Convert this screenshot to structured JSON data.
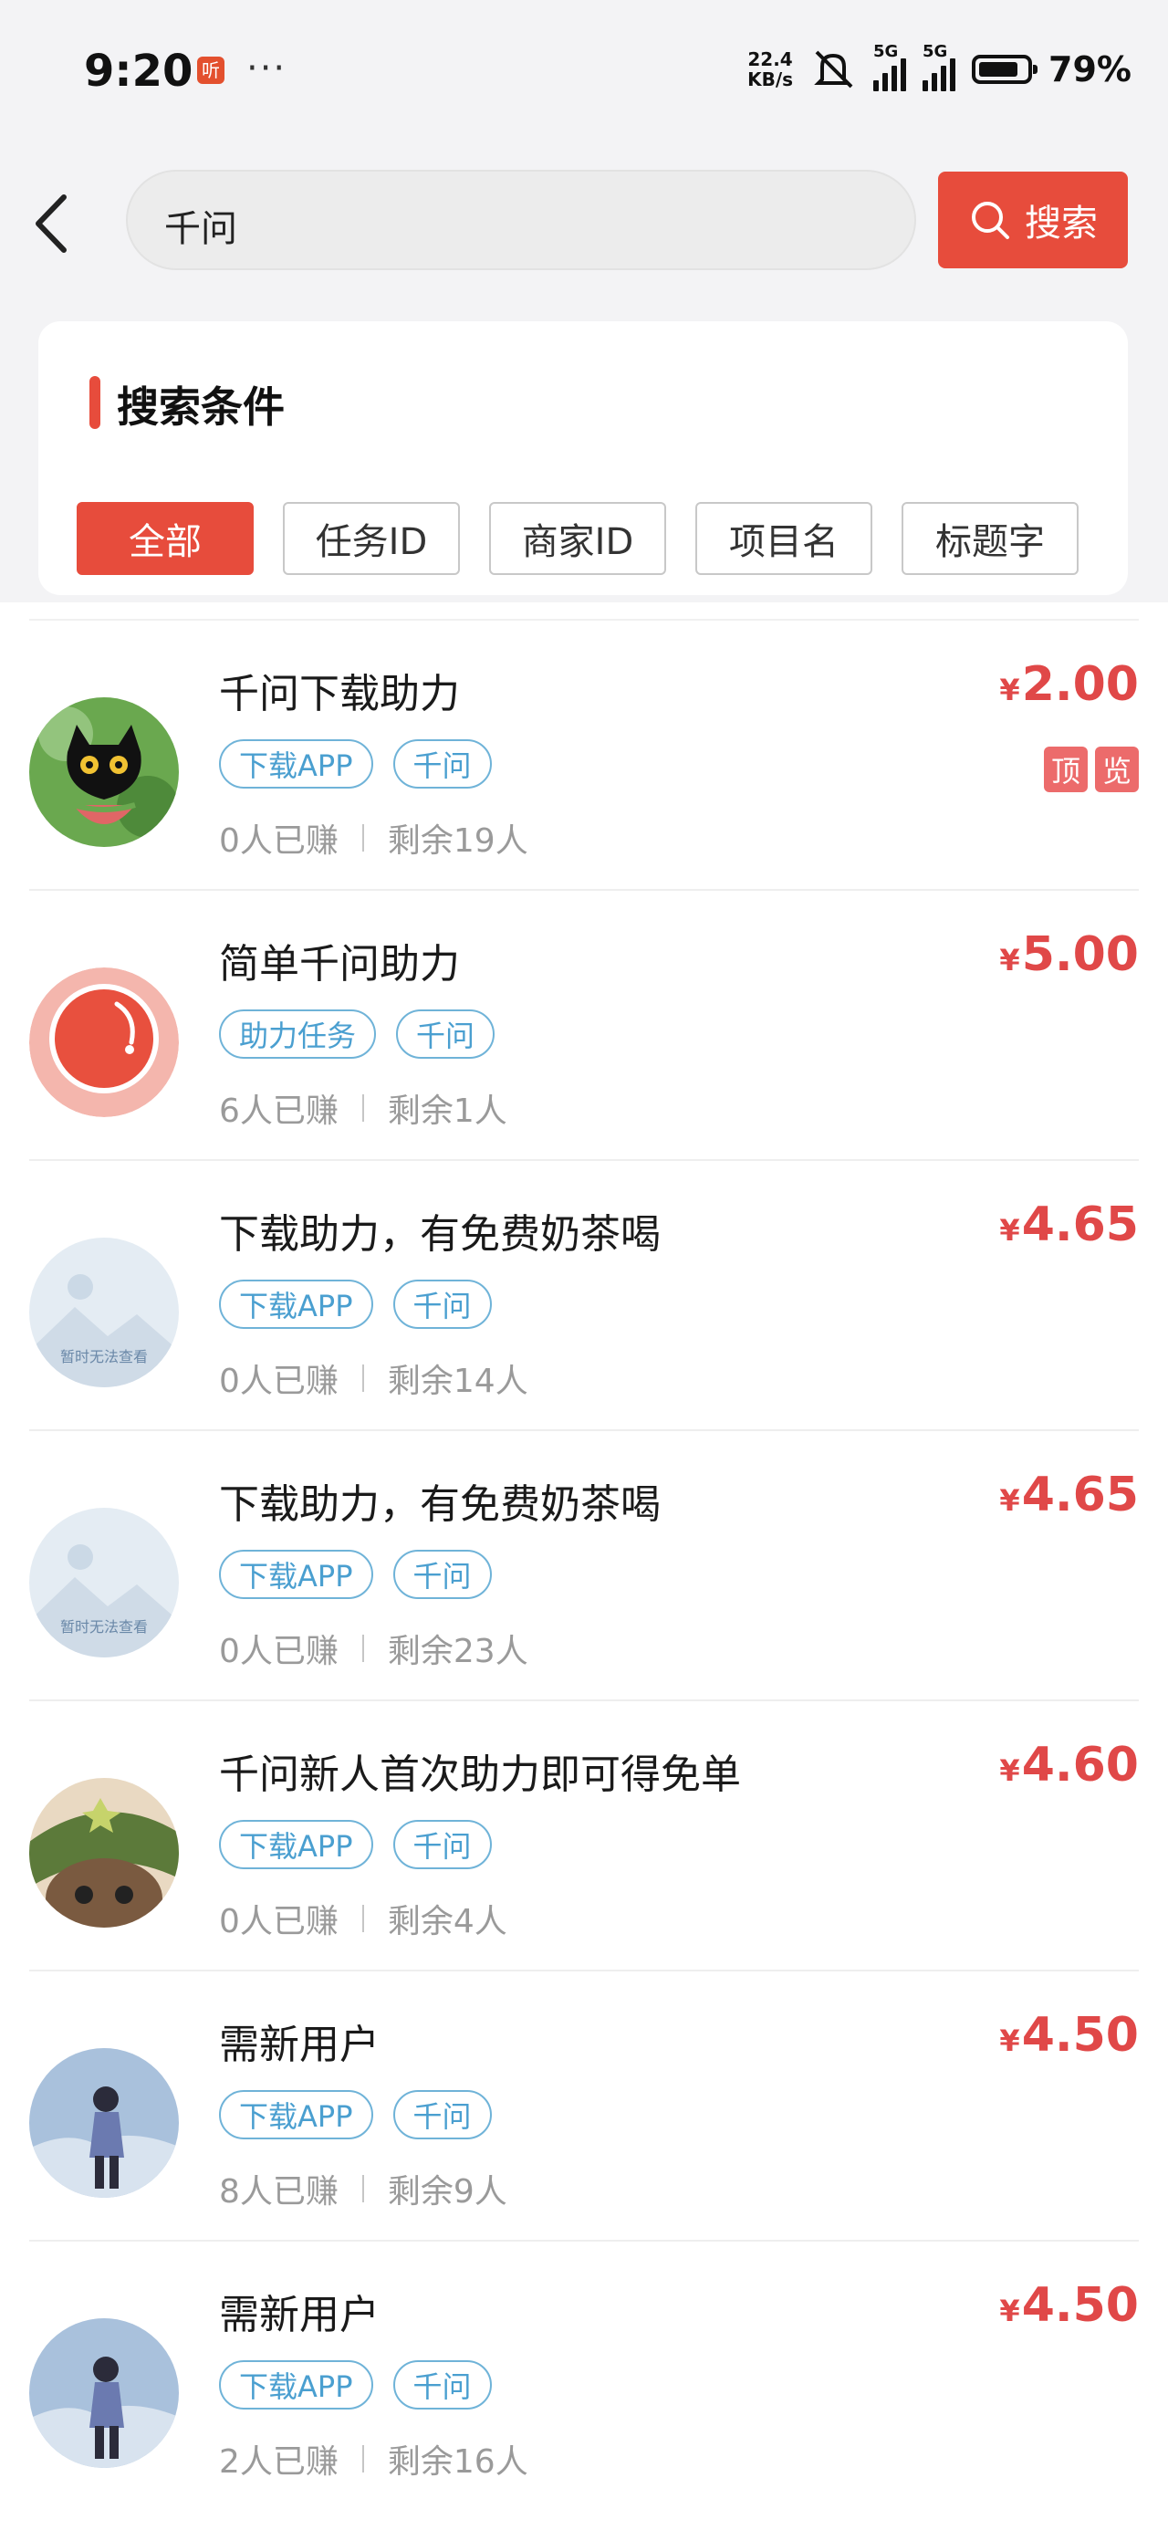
{
  "status_bar": {
    "time": "9:20",
    "app_badge": "听",
    "dots": "···",
    "net_speed_value": "22.4",
    "net_speed_unit": "KB/s",
    "signal1_label": "5G",
    "signal2_label": "5G",
    "battery_percent": "79%"
  },
  "search": {
    "query": "千问",
    "button_label": "搜索"
  },
  "filters": {
    "title": "搜索条件",
    "chips": [
      "全部",
      "任务ID",
      "商家ID",
      "项目名",
      "标题字"
    ],
    "active_index": 0
  },
  "colors": {
    "accent": "#e74c3c",
    "price": "#e04848",
    "tag": "#4a9fd0"
  },
  "placeholder_text": "暂时无法查看",
  "items": [
    {
      "title": "千问下载助力",
      "tags": [
        "下载APP",
        "千问"
      ],
      "earned": "0人已赚",
      "remaining": "剩余19人",
      "currency": "¥",
      "price": "2.00",
      "badges": [
        "顶",
        "览"
      ],
      "avatar": "black-cat-icon"
    },
    {
      "title": "简单千问助力",
      "tags": [
        "助力任务",
        "千问"
      ],
      "earned": "6人已赚",
      "remaining": "剩余1人",
      "currency": "¥",
      "price": "5.00",
      "badges": [],
      "avatar": "red-circle-logo"
    },
    {
      "title": "下载助力，有免费奶茶喝",
      "tags": [
        "下载APP",
        "千问"
      ],
      "earned": "0人已赚",
      "remaining": "剩余14人",
      "currency": "¥",
      "price": "4.65",
      "badges": [],
      "avatar": "placeholder-mountain"
    },
    {
      "title": "下载助力，有免费奶茶喝",
      "tags": [
        "下载APP",
        "千问"
      ],
      "earned": "0人已赚",
      "remaining": "剩余23人",
      "currency": "¥",
      "price": "4.65",
      "badges": [],
      "avatar": "placeholder-mountain"
    },
    {
      "title": "千问新人首次助力即可得免单",
      "tags": [
        "下载APP",
        "千问"
      ],
      "earned": "0人已赚",
      "remaining": "剩余4人",
      "currency": "¥",
      "price": "4.60",
      "badges": [],
      "avatar": "cat-hat-photo"
    },
    {
      "title": "需新用户",
      "tags": [
        "下载APP",
        "千问"
      ],
      "earned": "8人已赚",
      "remaining": "剩余9人",
      "currency": "¥",
      "price": "4.50",
      "badges": [],
      "avatar": "anime-boy-photo"
    },
    {
      "title": "需新用户",
      "tags": [
        "下载APP",
        "千问"
      ],
      "earned": "2人已赚",
      "remaining": "剩余16人",
      "currency": "¥",
      "price": "4.50",
      "badges": [],
      "avatar": "anime-boy-photo"
    }
  ]
}
